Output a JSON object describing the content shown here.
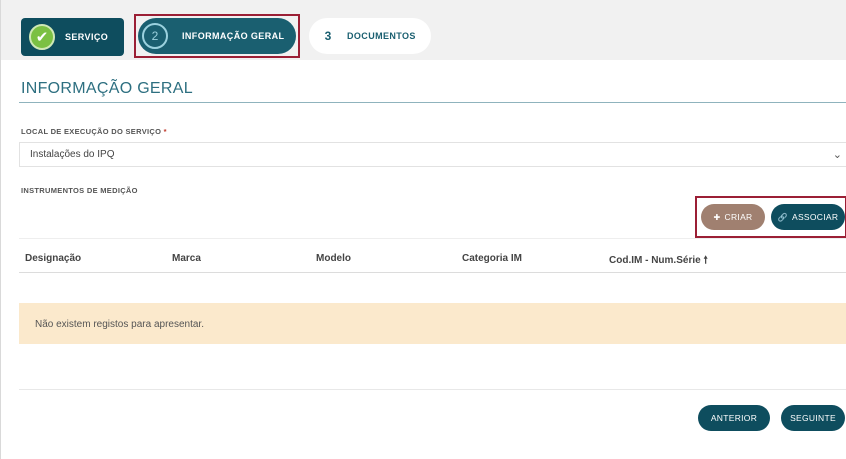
{
  "stepper": {
    "steps": [
      {
        "number": "",
        "label": "SERVIÇO",
        "state": "done"
      },
      {
        "number": "2",
        "label": "INFORMAÇÃO GERAL",
        "state": "active"
      },
      {
        "number": "3",
        "label": "DOCUMENTOS",
        "state": "pending"
      }
    ]
  },
  "section": {
    "title": "INFORMAÇÃO GERAL"
  },
  "local": {
    "label": "LOCAL DE EXECUÇÃO DO SERVIÇO",
    "required_mark": "*",
    "value": "Instalações do IPQ"
  },
  "instruments": {
    "label": "INSTRUMENTOS DE MEDIÇÃO",
    "criar_label": "CRIAR",
    "associar_label": "ASSOCIAR",
    "columns": [
      "Designação",
      "Marca",
      "Modelo",
      "Categoria IM",
      "Cod.IM - Num.Série"
    ],
    "sort_indicator": "🠕",
    "empty_message": "Não existem registos para apresentar."
  },
  "nav": {
    "anterior_label": "ANTERIOR",
    "seguinte_label": "SEGUINTE"
  },
  "colors": {
    "primary": "#0e4d5e",
    "highlight_border": "#9b1f35",
    "criar": "#a08070",
    "empty_bg": "#fbe9cc",
    "check": "#7bc043"
  }
}
